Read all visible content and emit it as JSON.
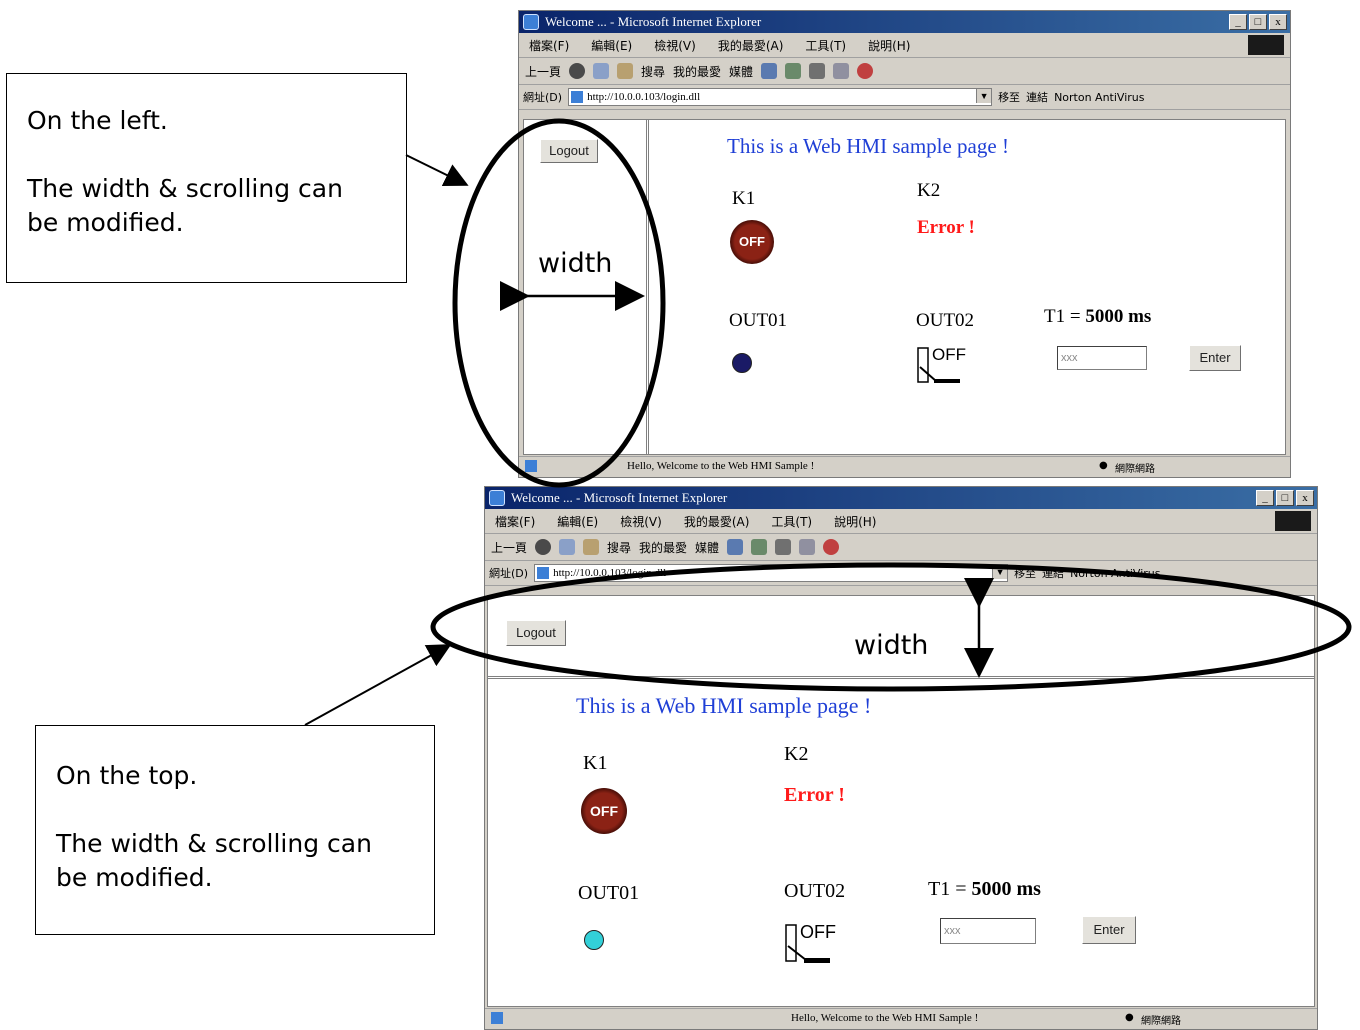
{
  "callouts": {
    "left": {
      "line1": "On the left.",
      "line2": "The width & scrolling can",
      "line3": "be modified."
    },
    "top": {
      "line1": "On the top.",
      "line2": "The width & scrolling can",
      "line3": "be modified."
    }
  },
  "annotation": {
    "width_label": "width"
  },
  "browser": {
    "title": "Welcome ... - Microsoft Internet Explorer",
    "title_buttons": [
      "_",
      "□",
      "x"
    ],
    "menu": [
      "檔案(F)",
      "編輯(E)",
      "檢視(V)",
      "我的最愛(A)",
      "工具(T)",
      "說明(H)"
    ],
    "toolbar": [
      "上一頁",
      "搜尋",
      "我的最愛",
      "媒體"
    ],
    "address_label": "網址(D)",
    "address_url": "http://10.0.0.103/login.dll",
    "go_label": "移至",
    "links_label": "連結",
    "antivirus_label": "Norton AntiVirus",
    "status_text": "Hello, Welcome to the Web HMI Sample !",
    "status_zone": "網際網路"
  },
  "hmi": {
    "logout_label": "Logout",
    "page_title": "This is a Web HMI sample page !",
    "k1_label": "K1",
    "k1_state": "OFF",
    "k2_label": "K2",
    "k2_status": "Error !",
    "out01_label": "OUT01",
    "out02_label": "OUT02",
    "out02_state": "OFF",
    "t1_prefix": "T1 = ",
    "t1_value": "5000 ms",
    "t1_input_value": "xxx",
    "enter_label": "Enter"
  },
  "colors": {
    "out01_led_left_window": "#1a1a66",
    "out01_led_top_window": "#33d0d8",
    "title_blue": "#1f3fd6",
    "error_red": "#ff1a1a"
  }
}
